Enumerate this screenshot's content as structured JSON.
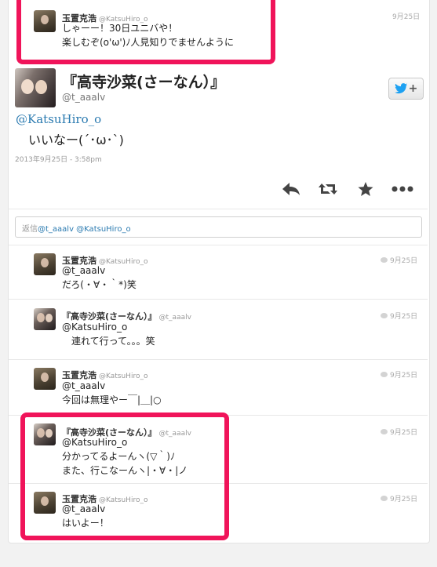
{
  "top_tweet": {
    "name": "玉置克浩",
    "handle": "@KatsuHiro_o",
    "time": "9月25日",
    "lines": [
      "しゃーー！30日ユニバや！",
      "楽しむぞ(o'ω')ﾉ人見知りでませんように"
    ]
  },
  "main_tweet": {
    "name": "『高寺沙菜(さーなん）』",
    "handle": "@t_aaalv",
    "mention": "@KatsuHiro_o",
    "body": "いいなー(´･ω･`)",
    "timestamp": "2013年9月25日 - 3:58pm",
    "follow_button_plus": "+"
  },
  "actions": {
    "reply": "reply-icon",
    "retweet": "retweet-icon",
    "favorite": "star-icon",
    "more": "more-icon"
  },
  "reply_box": {
    "prefix": "返信",
    "mentions": "@t_aaalv @KatsuHiro_o"
  },
  "replies": [
    {
      "name": "玉置克浩",
      "handle": "@KatsuHiro_o",
      "time": "9月25日",
      "lines": [
        "@t_aaalv",
        "だろ(・∀・｀*)笑"
      ],
      "avatar": "male"
    },
    {
      "name": "『高寺沙菜(さーなん）』",
      "handle": "@t_aaalv",
      "time": "9月25日",
      "lines": [
        "@KatsuHiro_o",
        "　連れて行って。。。笑"
      ],
      "avatar": "female"
    },
    {
      "name": "玉置克浩",
      "handle": "@KatsuHiro_o",
      "time": "9月25日",
      "lines": [
        "@t_aaalv",
        "今回は無理やー￣|＿|○"
      ],
      "avatar": "male"
    },
    {
      "name": "『高寺沙菜(さーなん）』",
      "handle": "@t_aaalv",
      "time": "9月25日",
      "lines": [
        "@KatsuHiro_o",
        "分かってるよーんヽ(▽｀)ﾉ",
        "また、行こなーんヽ|・∀・|ノ"
      ],
      "avatar": "female"
    },
    {
      "name": "玉置克浩",
      "handle": "@KatsuHiro_o",
      "time": "9月25日",
      "lines": [
        "@t_aaalv",
        "はいよー！"
      ],
      "avatar": "male"
    }
  ],
  "colors": {
    "highlight": "#f0145a",
    "link": "#2a7ab0",
    "twitter_blue": "#1da1f2"
  }
}
